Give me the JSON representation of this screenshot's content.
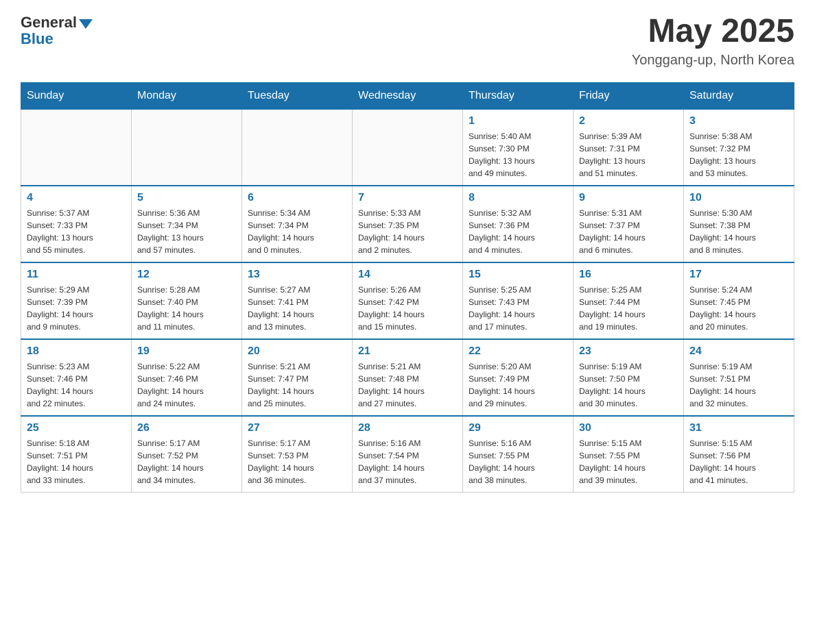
{
  "header": {
    "logo": {
      "general": "General",
      "blue": "Blue"
    },
    "title": "May 2025",
    "location": "Yonggang-up, North Korea"
  },
  "days_of_week": [
    "Sunday",
    "Monday",
    "Tuesday",
    "Wednesday",
    "Thursday",
    "Friday",
    "Saturday"
  ],
  "weeks": [
    {
      "cells": [
        {
          "day": "",
          "info": ""
        },
        {
          "day": "",
          "info": ""
        },
        {
          "day": "",
          "info": ""
        },
        {
          "day": "",
          "info": ""
        },
        {
          "day": "1",
          "info": "Sunrise: 5:40 AM\nSunset: 7:30 PM\nDaylight: 13 hours\nand 49 minutes."
        },
        {
          "day": "2",
          "info": "Sunrise: 5:39 AM\nSunset: 7:31 PM\nDaylight: 13 hours\nand 51 minutes."
        },
        {
          "day": "3",
          "info": "Sunrise: 5:38 AM\nSunset: 7:32 PM\nDaylight: 13 hours\nand 53 minutes."
        }
      ]
    },
    {
      "cells": [
        {
          "day": "4",
          "info": "Sunrise: 5:37 AM\nSunset: 7:33 PM\nDaylight: 13 hours\nand 55 minutes."
        },
        {
          "day": "5",
          "info": "Sunrise: 5:36 AM\nSunset: 7:34 PM\nDaylight: 13 hours\nand 57 minutes."
        },
        {
          "day": "6",
          "info": "Sunrise: 5:34 AM\nSunset: 7:34 PM\nDaylight: 14 hours\nand 0 minutes."
        },
        {
          "day": "7",
          "info": "Sunrise: 5:33 AM\nSunset: 7:35 PM\nDaylight: 14 hours\nand 2 minutes."
        },
        {
          "day": "8",
          "info": "Sunrise: 5:32 AM\nSunset: 7:36 PM\nDaylight: 14 hours\nand 4 minutes."
        },
        {
          "day": "9",
          "info": "Sunrise: 5:31 AM\nSunset: 7:37 PM\nDaylight: 14 hours\nand 6 minutes."
        },
        {
          "day": "10",
          "info": "Sunrise: 5:30 AM\nSunset: 7:38 PM\nDaylight: 14 hours\nand 8 minutes."
        }
      ]
    },
    {
      "cells": [
        {
          "day": "11",
          "info": "Sunrise: 5:29 AM\nSunset: 7:39 PM\nDaylight: 14 hours\nand 9 minutes."
        },
        {
          "day": "12",
          "info": "Sunrise: 5:28 AM\nSunset: 7:40 PM\nDaylight: 14 hours\nand 11 minutes."
        },
        {
          "day": "13",
          "info": "Sunrise: 5:27 AM\nSunset: 7:41 PM\nDaylight: 14 hours\nand 13 minutes."
        },
        {
          "day": "14",
          "info": "Sunrise: 5:26 AM\nSunset: 7:42 PM\nDaylight: 14 hours\nand 15 minutes."
        },
        {
          "day": "15",
          "info": "Sunrise: 5:25 AM\nSunset: 7:43 PM\nDaylight: 14 hours\nand 17 minutes."
        },
        {
          "day": "16",
          "info": "Sunrise: 5:25 AM\nSunset: 7:44 PM\nDaylight: 14 hours\nand 19 minutes."
        },
        {
          "day": "17",
          "info": "Sunrise: 5:24 AM\nSunset: 7:45 PM\nDaylight: 14 hours\nand 20 minutes."
        }
      ]
    },
    {
      "cells": [
        {
          "day": "18",
          "info": "Sunrise: 5:23 AM\nSunset: 7:46 PM\nDaylight: 14 hours\nand 22 minutes."
        },
        {
          "day": "19",
          "info": "Sunrise: 5:22 AM\nSunset: 7:46 PM\nDaylight: 14 hours\nand 24 minutes."
        },
        {
          "day": "20",
          "info": "Sunrise: 5:21 AM\nSunset: 7:47 PM\nDaylight: 14 hours\nand 25 minutes."
        },
        {
          "day": "21",
          "info": "Sunrise: 5:21 AM\nSunset: 7:48 PM\nDaylight: 14 hours\nand 27 minutes."
        },
        {
          "day": "22",
          "info": "Sunrise: 5:20 AM\nSunset: 7:49 PM\nDaylight: 14 hours\nand 29 minutes."
        },
        {
          "day": "23",
          "info": "Sunrise: 5:19 AM\nSunset: 7:50 PM\nDaylight: 14 hours\nand 30 minutes."
        },
        {
          "day": "24",
          "info": "Sunrise: 5:19 AM\nSunset: 7:51 PM\nDaylight: 14 hours\nand 32 minutes."
        }
      ]
    },
    {
      "cells": [
        {
          "day": "25",
          "info": "Sunrise: 5:18 AM\nSunset: 7:51 PM\nDaylight: 14 hours\nand 33 minutes."
        },
        {
          "day": "26",
          "info": "Sunrise: 5:17 AM\nSunset: 7:52 PM\nDaylight: 14 hours\nand 34 minutes."
        },
        {
          "day": "27",
          "info": "Sunrise: 5:17 AM\nSunset: 7:53 PM\nDaylight: 14 hours\nand 36 minutes."
        },
        {
          "day": "28",
          "info": "Sunrise: 5:16 AM\nSunset: 7:54 PM\nDaylight: 14 hours\nand 37 minutes."
        },
        {
          "day": "29",
          "info": "Sunrise: 5:16 AM\nSunset: 7:55 PM\nDaylight: 14 hours\nand 38 minutes."
        },
        {
          "day": "30",
          "info": "Sunrise: 5:15 AM\nSunset: 7:55 PM\nDaylight: 14 hours\nand 39 minutes."
        },
        {
          "day": "31",
          "info": "Sunrise: 5:15 AM\nSunset: 7:56 PM\nDaylight: 14 hours\nand 41 minutes."
        }
      ]
    }
  ]
}
